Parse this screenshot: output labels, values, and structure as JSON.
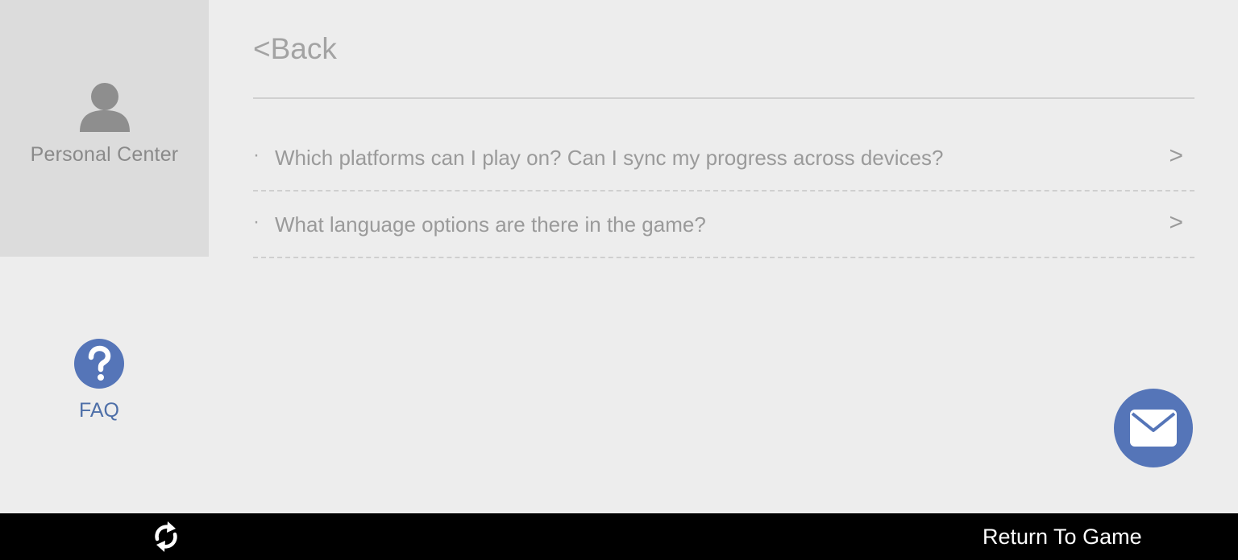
{
  "sidebar": {
    "personal_center": {
      "label": "Personal Center",
      "icon": "person-icon"
    },
    "faq": {
      "label": "FAQ",
      "icon": "question-circle-icon"
    }
  },
  "header": {
    "back_label": "<Back"
  },
  "faq_list": {
    "items": [
      {
        "bullet": "·",
        "question": "Which platforms can I play on? Can I sync my progress across devices?",
        "chevron": ">"
      },
      {
        "bullet": "·",
        "question": "What language options are there in the game?",
        "chevron": ">"
      }
    ]
  },
  "mail_button": {
    "icon": "envelope-icon"
  },
  "bottom_bar": {
    "refresh_icon": "refresh-icon",
    "return_label": "Return To Game"
  },
  "colors": {
    "accent": "#5575b8",
    "faq_label": "#4e6fa8",
    "background": "#ededed",
    "sidebar_panel": "#dcdcdc",
    "text_muted": "#9a9a9a",
    "bottom_bar": "#000000"
  }
}
